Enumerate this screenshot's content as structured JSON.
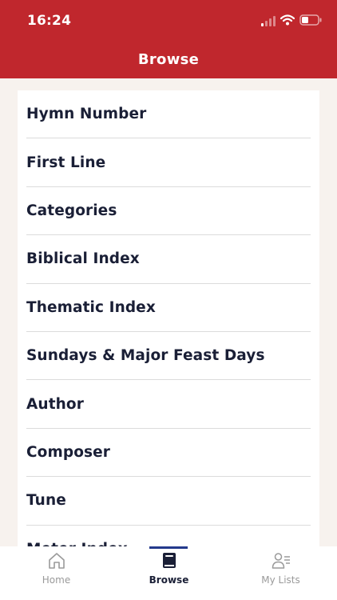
{
  "status": {
    "time": "16:24"
  },
  "header": {
    "title": "Browse"
  },
  "browse": {
    "items": [
      {
        "label": "Hymn Number"
      },
      {
        "label": "First Line"
      },
      {
        "label": "Categories"
      },
      {
        "label": "Biblical Index"
      },
      {
        "label": "Thematic Index"
      },
      {
        "label": "Sundays & Major Feast Days"
      },
      {
        "label": "Author"
      },
      {
        "label": "Composer"
      },
      {
        "label": "Tune"
      },
      {
        "label": "Meter Index"
      }
    ]
  },
  "tabs": [
    {
      "label": "Home",
      "icon": "home-icon",
      "active": false
    },
    {
      "label": "Browse",
      "icon": "book-icon",
      "active": true
    },
    {
      "label": "My Lists",
      "icon": "user-list-icon",
      "active": false
    }
  ],
  "colors": {
    "header_bg": "#c0272d",
    "page_bg": "#f7f2ee",
    "text_primary": "#1a1f36",
    "tab_indicator": "#243a8c",
    "tab_inactive": "#9a9a9a"
  }
}
